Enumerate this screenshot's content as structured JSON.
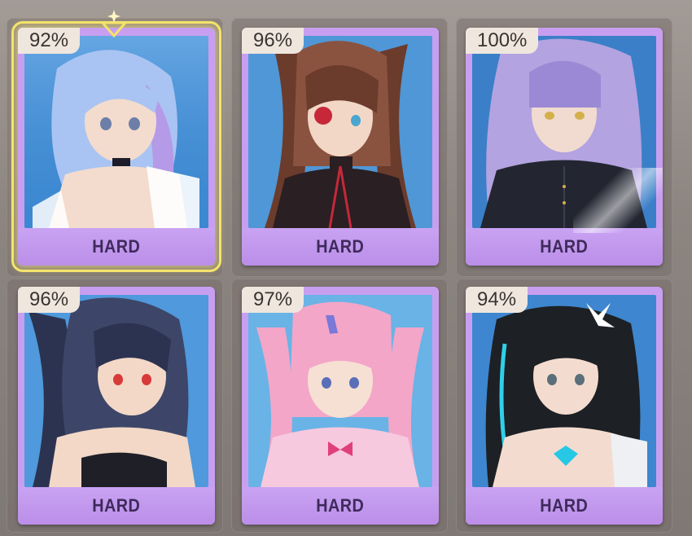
{
  "colors": {
    "card_frame": "#c89ff0",
    "label_text": "#3f2a5c",
    "badge_bg": "#efe6de",
    "selection_glow": "#f4e36b"
  },
  "stages": [
    {
      "percent": "92%",
      "difficulty": "HARD",
      "selected": true,
      "palette": {
        "bg": "#3f8fd8",
        "hair": "#a9c4f2",
        "hair2": "#b59ae8",
        "skin": "#f3dccd",
        "cloth": "#ffffff",
        "accent": "#1c1c2a"
      }
    },
    {
      "percent": "96%",
      "difficulty": "HARD",
      "selected": false,
      "palette": {
        "bg": "#4f97d6",
        "hair": "#6b3b2c",
        "hair2": "#8a5340",
        "skin": "#f2d7c6",
        "cloth": "#2a1f22",
        "accent": "#c6283a"
      }
    },
    {
      "percent": "100%",
      "difficulty": "HARD",
      "selected": false,
      "palette": {
        "bg": "#3b7fc8",
        "hair": "#b3a3e0",
        "hair2": "#9c89d6",
        "skin": "#f1dbd0",
        "cloth": "#232631",
        "accent": "#d4b04a"
      }
    },
    {
      "percent": "96%",
      "difficulty": "HARD",
      "selected": false,
      "palette": {
        "bg": "#4f99dc",
        "hair": "#2c3350",
        "hair2": "#3d4668",
        "skin": "#f3d8c7",
        "cloth": "#1f1f28",
        "accent": "#d83a3a"
      }
    },
    {
      "percent": "97%",
      "difficulty": "HARD",
      "selected": false,
      "palette": {
        "bg": "#69b3e6",
        "hair": "#f3a6c8",
        "hair2": "#7a78d8",
        "skin": "#f6e0d4",
        "cloth": "#f7c9de",
        "accent": "#e0407a"
      }
    },
    {
      "percent": "94%",
      "difficulty": "HARD",
      "selected": false,
      "palette": {
        "bg": "#3e86cf",
        "hair": "#1d2024",
        "hair2": "#2fd0e8",
        "skin": "#f3dccf",
        "cloth": "#eef0f3",
        "accent": "#27c7e6"
      }
    }
  ]
}
